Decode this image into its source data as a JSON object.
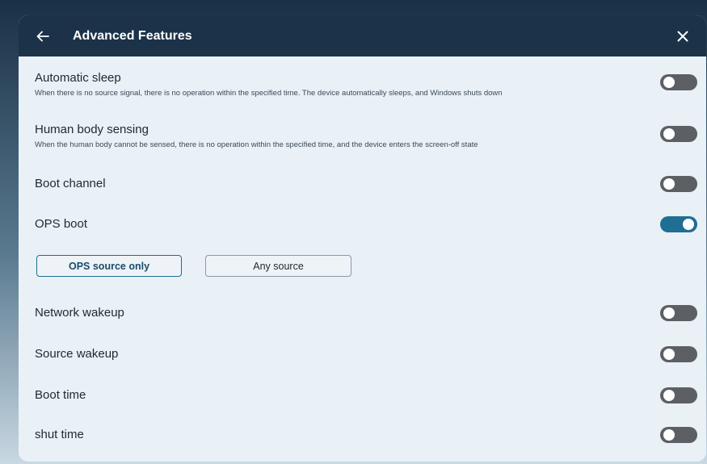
{
  "header": {
    "title": "Advanced Features"
  },
  "settings": [
    {
      "title": "Automatic sleep",
      "description": "When there is no source signal, there is no operation within the specified time. The device automatically sleeps, and Windows shuts down",
      "enabled": false
    },
    {
      "title": "Human body sensing",
      "description": "When the human body cannot be sensed, there is no operation within the specified time, and the device enters the screen-off state",
      "enabled": false
    },
    {
      "title": "Boot channel",
      "enabled": false
    },
    {
      "title": "OPS boot",
      "enabled": true
    },
    {
      "title": "Network wakeup",
      "enabled": false
    },
    {
      "title": "Source wakeup",
      "enabled": false
    },
    {
      "title": "Boot time",
      "enabled": false
    },
    {
      "title": "shut time",
      "enabled": false
    }
  ],
  "ops_source": {
    "options": [
      "OPS source only",
      "Any source"
    ],
    "selected": "OPS source only"
  },
  "colors": {
    "header_bg": "#1b3249",
    "panel_bg": "#e9f0f6",
    "toggle_on": "#1f6e93",
    "toggle_off": "#5c5f63"
  },
  "icons": {
    "back": "arrow-left-icon",
    "close": "close-icon"
  }
}
